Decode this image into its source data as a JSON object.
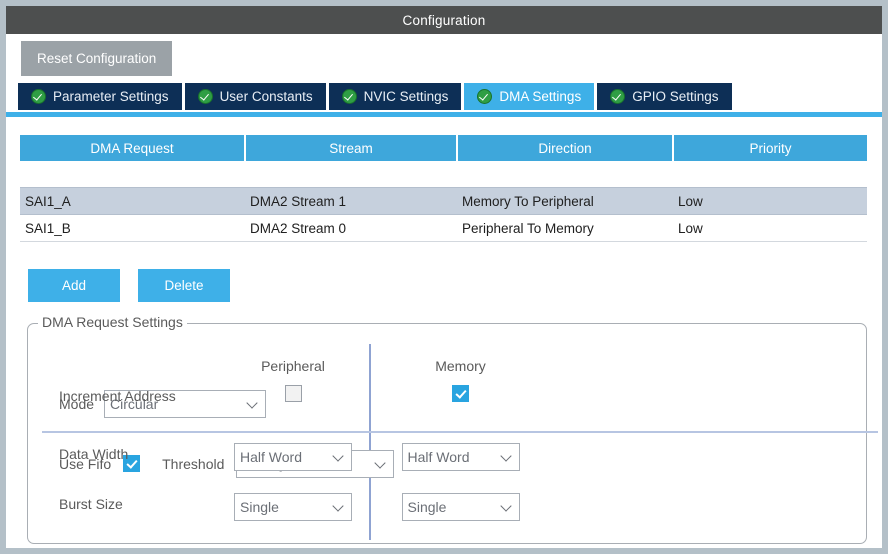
{
  "window": {
    "title": "Configuration"
  },
  "toolbar": {
    "reset_label": "Reset Configuration"
  },
  "tabs": [
    {
      "label": "Parameter Settings",
      "icon": "check-circle-icon",
      "active": false
    },
    {
      "label": "User Constants",
      "icon": "check-circle-icon",
      "active": false
    },
    {
      "label": "NVIC Settings",
      "icon": "check-circle-icon",
      "active": false
    },
    {
      "label": "DMA Settings",
      "icon": "check-circle-icon",
      "active": true
    },
    {
      "label": "GPIO Settings",
      "icon": "check-circle-icon",
      "active": false
    }
  ],
  "table": {
    "columns": [
      "DMA Request",
      "Stream",
      "Direction",
      "Priority"
    ],
    "rows": [
      {
        "dma_request": "SAI1_A",
        "stream": "DMA2 Stream 1",
        "direction": "Memory To Peripheral",
        "priority": "Low",
        "selected": true
      },
      {
        "dma_request": "SAI1_B",
        "stream": "DMA2 Stream 0",
        "direction": "Peripheral To Memory",
        "priority": "Low",
        "selected": false
      }
    ]
  },
  "buttons": {
    "add_label": "Add",
    "delete_label": "Delete"
  },
  "group": {
    "legend": "DMA Request Settings",
    "col_peripheral": "Peripheral",
    "col_memory": "Memory",
    "mode_label": "Mode",
    "mode_value": "Circular",
    "use_fifo_label": "Use Fifo",
    "use_fifo_checked": true,
    "threshold_label": "Threshold",
    "threshold_value": "One Quarter Full",
    "increment_address_label": "Increment Address",
    "increment_peripheral_checked": false,
    "increment_memory_checked": true,
    "data_width_label": "Data Width",
    "data_width_peripheral": "Half Word",
    "data_width_memory": "Half Word",
    "burst_size_label": "Burst Size",
    "burst_size_peripheral": "Single",
    "burst_size_memory": "Single"
  },
  "colors": {
    "accent_blue": "#3eb0e8",
    "header_blue": "#3ea7db",
    "tab_dark": "#0d2f56",
    "titlebar_gray": "#4d4f4f",
    "reset_gray": "#9ba2a7",
    "row_selected": "#c6d0dd",
    "divider_blue": "#8fa3d2"
  }
}
